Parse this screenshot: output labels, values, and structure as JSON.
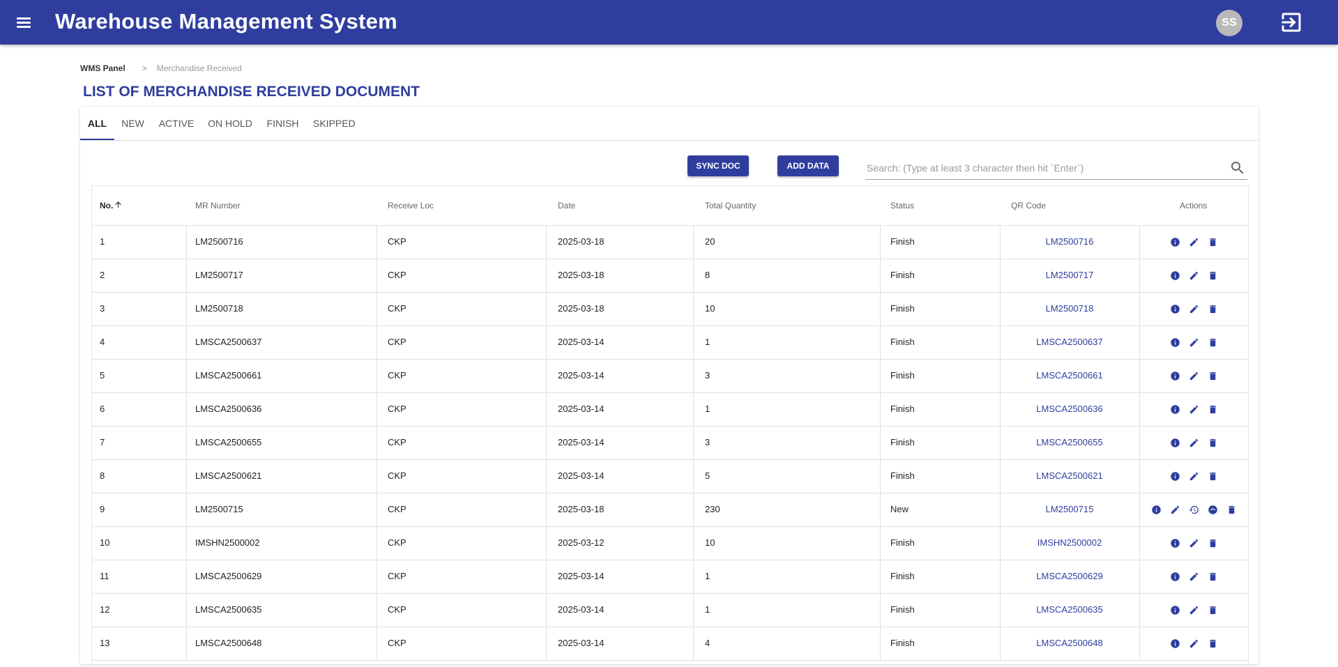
{
  "app": {
    "title": "Warehouse Management System",
    "user_initials": "SS"
  },
  "breadcrumb": {
    "root": "WMS Panel",
    "separator": ">",
    "current": "Merchandise Received"
  },
  "page": {
    "title": "LIST OF MERCHANDISE RECEIVED DOCUMENT"
  },
  "tabs": [
    "ALL",
    "NEW",
    "ACTIVE",
    "ON HOLD",
    "FINISH",
    "SKIPPED"
  ],
  "toolbar": {
    "sync_label": "SYNC DOC",
    "add_label": "ADD DATA"
  },
  "search": {
    "placeholder": "Search: (Type at least 3 character then hit `Enter`)",
    "value": ""
  },
  "table": {
    "columns": [
      "No.",
      "MR Number",
      "Receive Loc",
      "Date",
      "Total Quantity",
      "Status",
      "QR Code",
      "Actions"
    ],
    "rows": [
      {
        "no": "1",
        "mr": "LM2500716",
        "loc": "CKP",
        "date": "2025-03-18",
        "qty": "20",
        "status": "Finish",
        "qr": "LM2500716"
      },
      {
        "no": "2",
        "mr": "LM2500717",
        "loc": "CKP",
        "date": "2025-03-18",
        "qty": "8",
        "status": "Finish",
        "qr": "LM2500717"
      },
      {
        "no": "3",
        "mr": "LM2500718",
        "loc": "CKP",
        "date": "2025-03-18",
        "qty": "10",
        "status": "Finish",
        "qr": "LM2500718"
      },
      {
        "no": "4",
        "mr": "LMSCA2500637",
        "loc": "CKP",
        "date": "2025-03-14",
        "qty": "1",
        "status": "Finish",
        "qr": "LMSCA2500637"
      },
      {
        "no": "5",
        "mr": "LMSCA2500661",
        "loc": "CKP",
        "date": "2025-03-14",
        "qty": "3",
        "status": "Finish",
        "qr": "LMSCA2500661"
      },
      {
        "no": "6",
        "mr": "LMSCA2500636",
        "loc": "CKP",
        "date": "2025-03-14",
        "qty": "1",
        "status": "Finish",
        "qr": "LMSCA2500636"
      },
      {
        "no": "7",
        "mr": "LMSCA2500655",
        "loc": "CKP",
        "date": "2025-03-14",
        "qty": "3",
        "status": "Finish",
        "qr": "LMSCA2500655"
      },
      {
        "no": "8",
        "mr": "LMSCA2500621",
        "loc": "CKP",
        "date": "2025-03-14",
        "qty": "5",
        "status": "Finish",
        "qr": "LMSCA2500621"
      },
      {
        "no": "9",
        "mr": "LM2500715",
        "loc": "CKP",
        "date": "2025-03-18",
        "qty": "230",
        "status": "New",
        "qr": "LM2500715"
      },
      {
        "no": "10",
        "mr": "IMSHN2500002",
        "loc": "CKP",
        "date": "2025-03-12",
        "qty": "10",
        "status": "Finish",
        "qr": "IMSHN2500002"
      },
      {
        "no": "11",
        "mr": "LMSCA2500629",
        "loc": "CKP",
        "date": "2025-03-14",
        "qty": "1",
        "status": "Finish",
        "qr": "LMSCA2500629"
      },
      {
        "no": "12",
        "mr": "LMSCA2500635",
        "loc": "CKP",
        "date": "2025-03-14",
        "qty": "1",
        "status": "Finish",
        "qr": "LMSCA2500635"
      },
      {
        "no": "13",
        "mr": "LMSCA2500648",
        "loc": "CKP",
        "date": "2025-03-14",
        "qty": "4",
        "status": "Finish",
        "qr": "LMSCA2500648"
      }
    ]
  },
  "colors": {
    "primary": "#2f3e9e",
    "link": "#2f3e9e",
    "avatar": "#b9b9b9"
  },
  "icons": {
    "menu": "menu-icon",
    "logout": "logout-icon",
    "search": "search-icon",
    "sort": "arrow-up-icon",
    "info": "info-icon",
    "edit": "pencil-icon",
    "delete": "trash-icon",
    "restore": "history-icon",
    "progress": "progress-icon"
  }
}
